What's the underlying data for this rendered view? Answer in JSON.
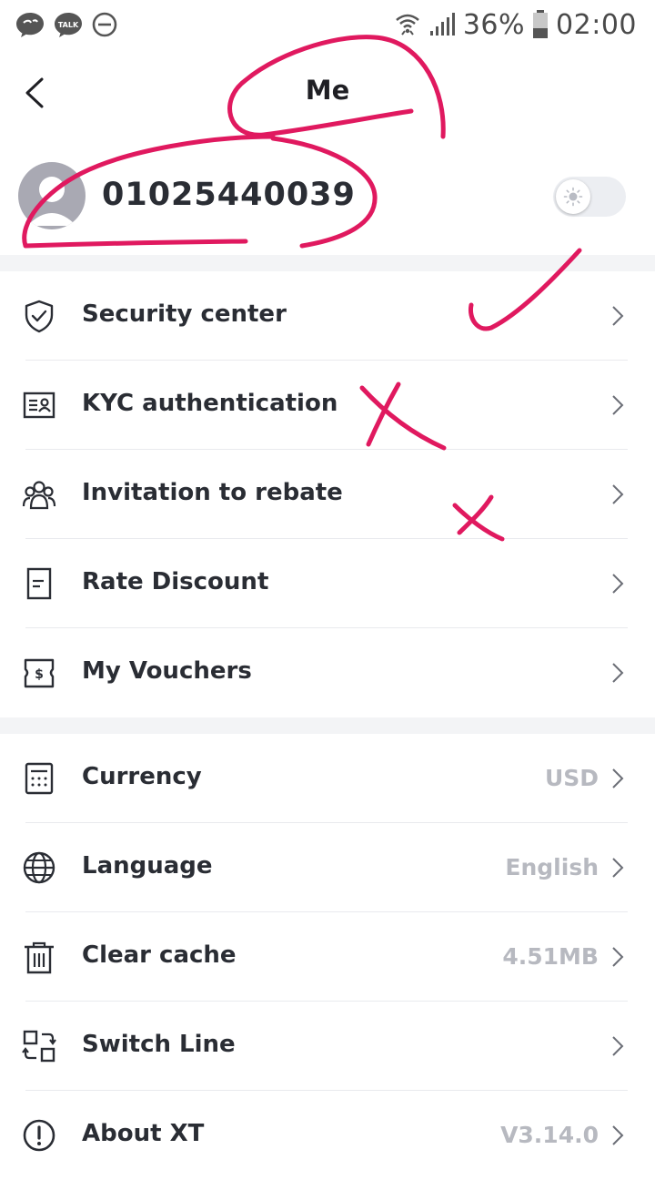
{
  "status_bar": {
    "battery": "36%",
    "time": "02:00",
    "icons": [
      "chat-icon",
      "talk-icon",
      "do-not-disturb-icon",
      "wifi-icon",
      "signal-icon",
      "battery-icon"
    ]
  },
  "header": {
    "title": "Me",
    "back_icon": "chevron-left-icon"
  },
  "profile": {
    "username": "01025440039",
    "avatar_icon": "user-avatar-icon",
    "theme_toggle_icon": "sun-icon"
  },
  "menu_group_1": [
    {
      "label": "Security center",
      "icon": "shield-check-icon"
    },
    {
      "label": "KYC authentication",
      "icon": "id-card-icon"
    },
    {
      "label": "Invitation to rebate",
      "icon": "users-icon"
    },
    {
      "label": "Rate Discount",
      "icon": "document-icon"
    },
    {
      "label": "My Vouchers",
      "icon": "voucher-icon"
    }
  ],
  "menu_group_2": [
    {
      "label": "Currency",
      "value": "USD",
      "icon": "calculator-icon"
    },
    {
      "label": "Language",
      "value": "English",
      "icon": "globe-icon"
    },
    {
      "label": "Clear cache",
      "value": "4.51MB",
      "icon": "trash-icon"
    },
    {
      "label": "Switch Line",
      "value": "",
      "icon": "switch-icon"
    },
    {
      "label": "About XT",
      "value": "V3.14.0",
      "icon": "info-icon"
    }
  ],
  "colors": {
    "text": "#2a2d34",
    "secondary": "#b7b9c0",
    "divider": "#f3f4f6",
    "annotation": "#e0195f"
  }
}
